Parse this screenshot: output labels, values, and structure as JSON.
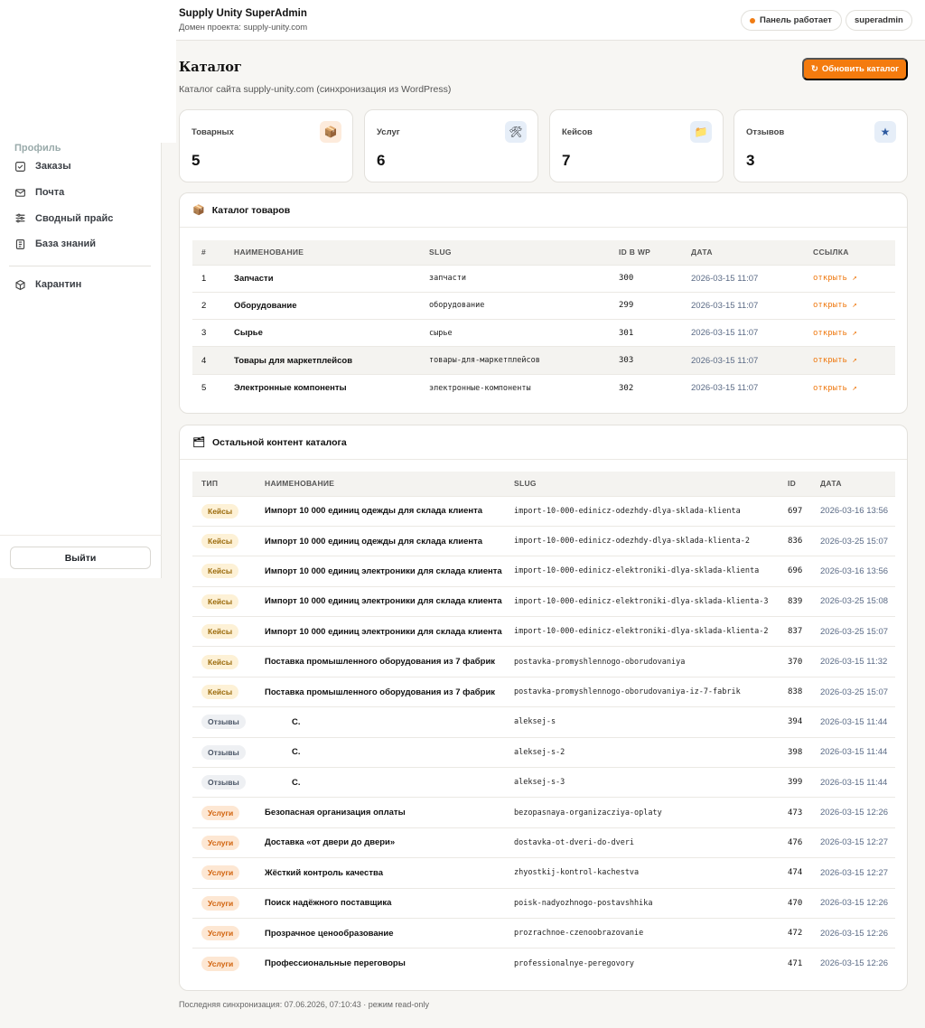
{
  "header": {
    "app_title": "Supply Unity SuperAdmin",
    "domain_label": "Домен проекта: supply-unity.com",
    "status_label": "Панель работает",
    "user_label": "superadmin"
  },
  "sidebar": {
    "partial_item": "Профиль",
    "items": [
      {
        "label": "Заказы",
        "icon": "clipboard-check-icon"
      },
      {
        "label": "Почта",
        "icon": "mail-icon"
      },
      {
        "label": "Сводный прайс",
        "icon": "sliders-icon"
      },
      {
        "label": "База знаний",
        "icon": "book-icon"
      }
    ],
    "quarantine": {
      "label": "Карантин",
      "icon": "box-icon"
    },
    "logout_label": "Выйти"
  },
  "page": {
    "title": "Каталог",
    "subtitle": "Каталог сайта supply-unity.com (синхронизация из WordPress)",
    "refresh_label": "Обновить каталог",
    "refresh_icon": "↻"
  },
  "stats": [
    {
      "label": "Товарных",
      "value": "5",
      "icon": "📦",
      "icon_bg": "#fdebdc"
    },
    {
      "label": "Услуг",
      "value": "6",
      "icon": "🛠",
      "icon_bg": "#e6eef8"
    },
    {
      "label": "Кейсов",
      "value": "7",
      "icon": "📁",
      "icon_bg": "#e6eef8"
    },
    {
      "label": "Отзывов",
      "value": "3",
      "icon": "★",
      "icon_bg": "#e6eef8"
    }
  ],
  "catalog": {
    "title": "Каталог товаров",
    "icon": "📦",
    "columns": [
      "#",
      "НАИМЕНОВАНИЕ",
      "SLUG",
      "ID В WP",
      "ДАТА",
      "ССЫЛКА"
    ],
    "link_label": "открыть ↗",
    "rows": [
      {
        "n": "1",
        "name": "Запчасти",
        "slug": "запчасти",
        "id": "300",
        "date": "2026-03-15 11:07"
      },
      {
        "n": "2",
        "name": "Оборудование",
        "slug": "оборудование",
        "id": "299",
        "date": "2026-03-15 11:07"
      },
      {
        "n": "3",
        "name": "Сырье",
        "slug": "сырье",
        "id": "301",
        "date": "2026-03-15 11:07"
      },
      {
        "n": "4",
        "name": "Товары для маркетплейсов",
        "slug": "товары-для-маркетплейсов",
        "id": "303",
        "date": "2026-03-15 11:07"
      },
      {
        "n": "5",
        "name": "Электронные компоненты",
        "slug": "электронные-компоненты",
        "id": "302",
        "date": "2026-03-15 11:07"
      }
    ]
  },
  "other": {
    "title": "Остальной контент каталога",
    "icon": "🗂",
    "columns": [
      "ТИП",
      "НАИМЕНОВАНИЕ",
      "SLUG",
      "ID",
      "ДАТА"
    ],
    "rows": [
      {
        "type": "Кейсы",
        "kind": "case",
        "name": "Импорт 10 000 единиц одежды для склада клиента",
        "slug": "import-10-000-edinicz-odezhdy-dlya-sklada-klienta",
        "id": "697",
        "date": "2026-03-16 13:56"
      },
      {
        "type": "Кейсы",
        "kind": "case",
        "name": "Импорт 10 000 единиц одежды для склада клиента",
        "slug": "import-10-000-edinicz-odezhdy-dlya-sklada-klienta-2",
        "id": "836",
        "date": "2026-03-25 15:07"
      },
      {
        "type": "Кейсы",
        "kind": "case",
        "name": "Импорт 10 000 единиц электроники для склада клиента",
        "slug": "import-10-000-edinicz-elektroniki-dlya-sklada-klienta",
        "id": "696",
        "date": "2026-03-16 13:56"
      },
      {
        "type": "Кейсы",
        "kind": "case",
        "name": "Импорт 10 000 единиц электроники для склада клиента",
        "slug": "import-10-000-edinicz-elektroniki-dlya-sklada-klienta-3",
        "id": "839",
        "date": "2026-03-25 15:08"
      },
      {
        "type": "Кейсы",
        "kind": "case",
        "name": "Импорт 10 000 единиц электроники для склада клиента",
        "slug": "import-10-000-edinicz-elektroniki-dlya-sklada-klienta-2",
        "id": "837",
        "date": "2026-03-25 15:07"
      },
      {
        "type": "Кейсы",
        "kind": "case",
        "name": "Поставка промышленного оборудования из 7 фабрик",
        "slug": "postavka-promyshlennogo-oborudovaniya",
        "id": "370",
        "date": "2026-03-15 11:32"
      },
      {
        "type": "Кейсы",
        "kind": "case",
        "name": "Поставка промышленного оборудования из 7 фабрик",
        "slug": "postavka-promyshlennogo-oborudovaniya-iz-7-fabrik",
        "id": "838",
        "date": "2026-03-25 15:07"
      },
      {
        "type": "Отзывы",
        "kind": "rev",
        "name": "С.",
        "slug": "aleksej-s",
        "id": "394",
        "date": "2026-03-15 11:44"
      },
      {
        "type": "Отзывы",
        "kind": "rev",
        "name": "С.",
        "slug": "aleksej-s-2",
        "id": "398",
        "date": "2026-03-15 11:44"
      },
      {
        "type": "Отзывы",
        "kind": "rev",
        "name": "С.",
        "slug": "aleksej-s-3",
        "id": "399",
        "date": "2026-03-15 11:44"
      },
      {
        "type": "Услуги",
        "kind": "srv",
        "name": "Безопасная организация оплаты",
        "slug": "bezopasnaya-organizacziya-oplaty",
        "id": "473",
        "date": "2026-03-15 12:26"
      },
      {
        "type": "Услуги",
        "kind": "srv",
        "name": "Доставка «от двери до двери»",
        "slug": "dostavka-ot-dveri-do-dveri",
        "id": "476",
        "date": "2026-03-15 12:27"
      },
      {
        "type": "Услуги",
        "kind": "srv",
        "name": "Жёсткий контроль качества",
        "slug": "zhyostkij-kontrol-kachestva",
        "id": "474",
        "date": "2026-03-15 12:27"
      },
      {
        "type": "Услуги",
        "kind": "srv",
        "name": "Поиск надёжного поставщика",
        "slug": "poisk-nadyozhnogo-postavshhika",
        "id": "470",
        "date": "2026-03-15 12:26"
      },
      {
        "type": "Услуги",
        "kind": "srv",
        "name": "Прозрачное ценообразование",
        "slug": "prozrachnoe-czenoobrazovanie",
        "id": "472",
        "date": "2026-03-15 12:26"
      },
      {
        "type": "Услуги",
        "kind": "srv",
        "name": "Профессиональные переговоры",
        "slug": "professionalnye-peregovory",
        "id": "471",
        "date": "2026-03-15 12:26"
      }
    ]
  },
  "footer": {
    "note": "Последняя синхронизация: 07.06.2026, 07:10:43 · режим read-only"
  }
}
